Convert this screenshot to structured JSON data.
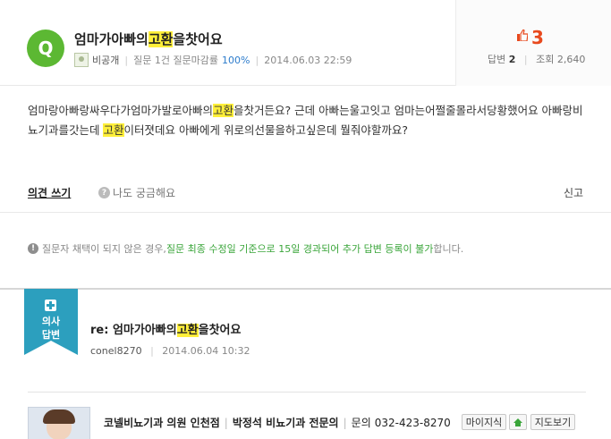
{
  "question": {
    "badge": "Q",
    "title_pre": "엄마가아빠의",
    "title_hl": "고환",
    "title_post": "을찻어요",
    "user": "비공개",
    "stat_label": "질문 1건 질문마감률",
    "stat_rate": "100%",
    "date": "2014.06.03 22:59",
    "likes": "3",
    "answers_label": "답변",
    "answers_count": "2",
    "views_label": "조회",
    "views_count": "2,640",
    "body_1": "엄마랑아빠랑싸우다가엄마가발로아빠의",
    "body_hl1": "고환",
    "body_2": "을찻거든요? 근데 아빠는울고잇고 엄마는어쩔줄몰라서당황했어요 아빠랑비뇨기과를갓는데 ",
    "body_hl2": "고환",
    "body_3": "이터졋데요 아빠에게 위로의선물을하고싶은데 뭘줘야할까요?"
  },
  "actions": {
    "opinion": "의견 쓰기",
    "curious": "나도 궁금해요",
    "report": "신고"
  },
  "notice": {
    "icon": "!",
    "text_1": "질문자 채택이 되지 않은 경우, ",
    "text_green": "질문 최종 수정일 기준으로 15일 경과되어 추가 답변 등록이 불가",
    "text_2": "합니다."
  },
  "answer": {
    "ribbon_line1": "의사",
    "ribbon_line2": "답변",
    "title_pre": "re: 엄마가아빠의",
    "title_hl": "고환",
    "title_post": "을찻어요",
    "user": "conel8270",
    "date": "2014.06.04 10:32"
  },
  "doctor": {
    "clinic": "코넬비뇨기과 의원 인천점",
    "name": "박정석 비뇨기과 전문의",
    "contact_label": "문의",
    "phone": "032-423-8270",
    "btn_map": "마이지식",
    "btn_directions": "지도보기"
  },
  "colors": {
    "accent_green": "#5cb833",
    "like_orange": "#e8491d",
    "highlight": "#ffef3a",
    "ribbon_blue": "#2c9fbe",
    "notice_green": "#3aa53a"
  }
}
